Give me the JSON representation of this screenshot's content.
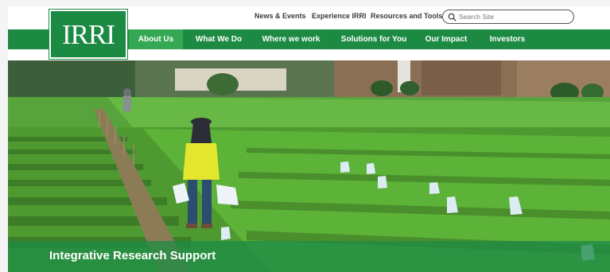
{
  "logo": {
    "text": "IRRI"
  },
  "utility": {
    "links": [
      "News & Events",
      "Experience IRRI",
      "Resources and Tools"
    ],
    "search_placeholder": "Search Site",
    "search_value": ""
  },
  "nav": {
    "items": [
      "About Us",
      "What We Do",
      "Where we work",
      "Solutions for You",
      "Our Impact",
      "Investors"
    ],
    "active": "About Us"
  },
  "hero": {
    "title": "Integrative Research Support",
    "image_subject": "worker-in-rice-field-photo"
  },
  "colors": {
    "brand_green": "#1d8a44",
    "active_green": "#34a853",
    "banner_green": "#1e8c46"
  }
}
